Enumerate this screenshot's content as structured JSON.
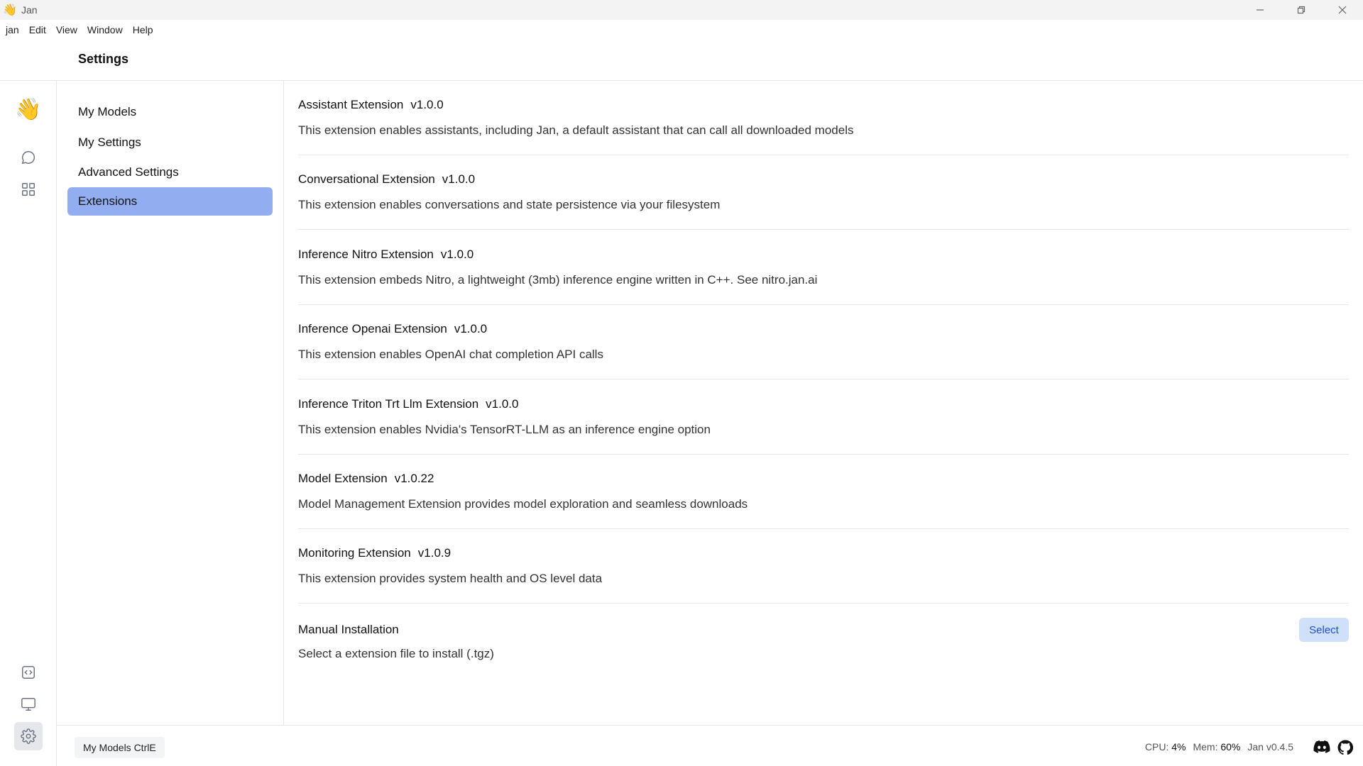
{
  "window": {
    "title": "Jan",
    "app_icon": "👋"
  },
  "menu": [
    "jan",
    "Edit",
    "View",
    "Window",
    "Help"
  ],
  "header": {
    "title": "Settings"
  },
  "rail": {
    "logo": "👋",
    "icons": [
      "chat-icon",
      "apps-grid-icon",
      "code-icon",
      "monitor-icon",
      "gear-icon"
    ]
  },
  "settings_nav": [
    {
      "label": "My Models",
      "active": false
    },
    {
      "label": "My Settings",
      "active": false
    },
    {
      "label": "Advanced Settings",
      "active": false
    },
    {
      "label": "Extensions",
      "active": true
    }
  ],
  "extensions": [
    {
      "name": "Assistant Extension",
      "version": "v1.0.0",
      "description": "This extension enables assistants, including Jan, a default assistant that can call all downloaded models"
    },
    {
      "name": "Conversational Extension",
      "version": "v1.0.0",
      "description": "This extension enables conversations and state persistence via your filesystem"
    },
    {
      "name": "Inference Nitro Extension",
      "version": "v1.0.0",
      "description": "This extension embeds Nitro, a lightweight (3mb) inference engine written in C++. See nitro.jan.ai"
    },
    {
      "name": "Inference Openai Extension",
      "version": "v1.0.0",
      "description": "This extension enables OpenAI chat completion API calls"
    },
    {
      "name": "Inference Triton Trt Llm Extension",
      "version": "v1.0.0",
      "description": "This extension enables Nvidia's TensorRT-LLM as an inference engine option"
    },
    {
      "name": "Model Extension",
      "version": "v1.0.22",
      "description": "Model Management Extension provides model exploration and seamless downloads"
    },
    {
      "name": "Monitoring Extension",
      "version": "v1.0.9",
      "description": "This extension provides system health and OS level data"
    }
  ],
  "manual_install": {
    "title": "Manual Installation",
    "description": "Select a extension file to install (.tgz)",
    "button": "Select"
  },
  "bottom": {
    "shortcut": "My Models CtrlE",
    "cpu_label": "CPU:",
    "cpu_value": "4%",
    "mem_label": "Mem:",
    "mem_value": "60%",
    "version": "Jan v0.4.5"
  },
  "colors": {
    "active_nav": "#93aef0",
    "select_button_bg": "#cfe0fb",
    "select_button_text": "#1d4ed8"
  }
}
